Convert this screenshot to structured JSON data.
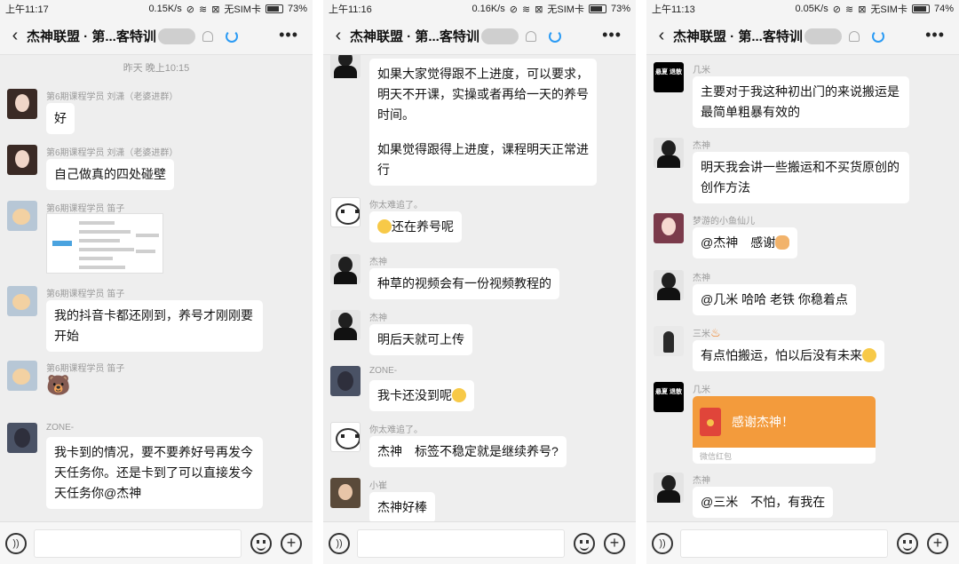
{
  "panels": [
    {
      "status": {
        "time": "上午11:17",
        "speed": "0.15K/s",
        "carrier": "无SIM卡",
        "battery": "73%",
        "battery_level": 0.73
      },
      "title": "杰神联盟 · 第...客特训",
      "date_separator": "昨天 晚上10:15",
      "messages": [
        {
          "sender": "第6期课程学员 刘潇（老婆进群）",
          "text": "好"
        },
        {
          "sender": "第6期课程学员 刘潇（老婆进群）",
          "text": "自己做真的四处碰壁"
        },
        {
          "sender": "第6期课程学员 笛子",
          "type": "image"
        },
        {
          "sender": "第6期课程学员 笛子",
          "text": "我的抖音卡都还刚到，养号才刚刚要开始"
        },
        {
          "sender": "第6期课程学员 笛子",
          "type": "sticker"
        },
        {
          "sender": "ZONE-",
          "text": "我卡到的情况，要不要养好号再发今天任务你。还是卡到了可以直接发今天任务你@杰神"
        }
      ]
    },
    {
      "status": {
        "time": "上午11:16",
        "speed": "0.16K/s",
        "carrier": "无SIM卡",
        "battery": "73%",
        "battery_level": 0.73
      },
      "title": "杰神联盟 · 第...客特训",
      "messages": [
        {
          "sender": "",
          "text": "如果大家觉得跟不上进度，可以要求，明天不开课，实操或者再给一天的养号时间。"
        },
        {
          "sender": "",
          "text": "如果觉得跟得上进度，课程明天正常进行"
        },
        {
          "sender": "你太难追了。",
          "text": "还在养号呢"
        },
        {
          "sender": "杰神",
          "text": "种草的视频会有一份视频教程的"
        },
        {
          "sender": "杰神",
          "text": "明后天就可上传"
        },
        {
          "sender": "ZONE-",
          "text": "我卡还没到呢"
        },
        {
          "sender": "你太难追了。",
          "text": "杰神　标签不稳定就是继续养号?"
        },
        {
          "sender": "小崔",
          "text": "杰神好棒"
        }
      ]
    },
    {
      "status": {
        "time": "上午11:13",
        "speed": "0.05K/s",
        "carrier": "无SIM卡",
        "battery": "74%",
        "battery_level": 0.74
      },
      "title": "杰神联盟 · 第...客特训",
      "messages": [
        {
          "sender": "几米",
          "text": "主要对于我这种初出门的来说搬运是最简单粗暴有效的",
          "avatar_text": "悬夏 退散"
        },
        {
          "sender": "杰神",
          "text": "明天我会讲一些搬运和不买货原创的创作方法"
        },
        {
          "sender": "梦游的小鱼仙儿",
          "text": "@杰神　感谢"
        },
        {
          "sender": "杰神",
          "text": "@几米 哈哈 老铁 你稳着点"
        },
        {
          "sender": "三米",
          "text": "有点怕搬运，怕以后没有未来"
        },
        {
          "sender": "几米",
          "type": "red_packet",
          "text": "感谢杰神！",
          "footer": "微信红包",
          "avatar_text": "悬夏 退散"
        },
        {
          "sender": "杰神",
          "text": "@三米　不怕，有我在"
        }
      ]
    }
  ],
  "colors": {
    "background": "#eeeeee",
    "bubble": "#ffffff",
    "red_packet": "#f39b3c",
    "loading_ring": "#2b9bf4"
  }
}
